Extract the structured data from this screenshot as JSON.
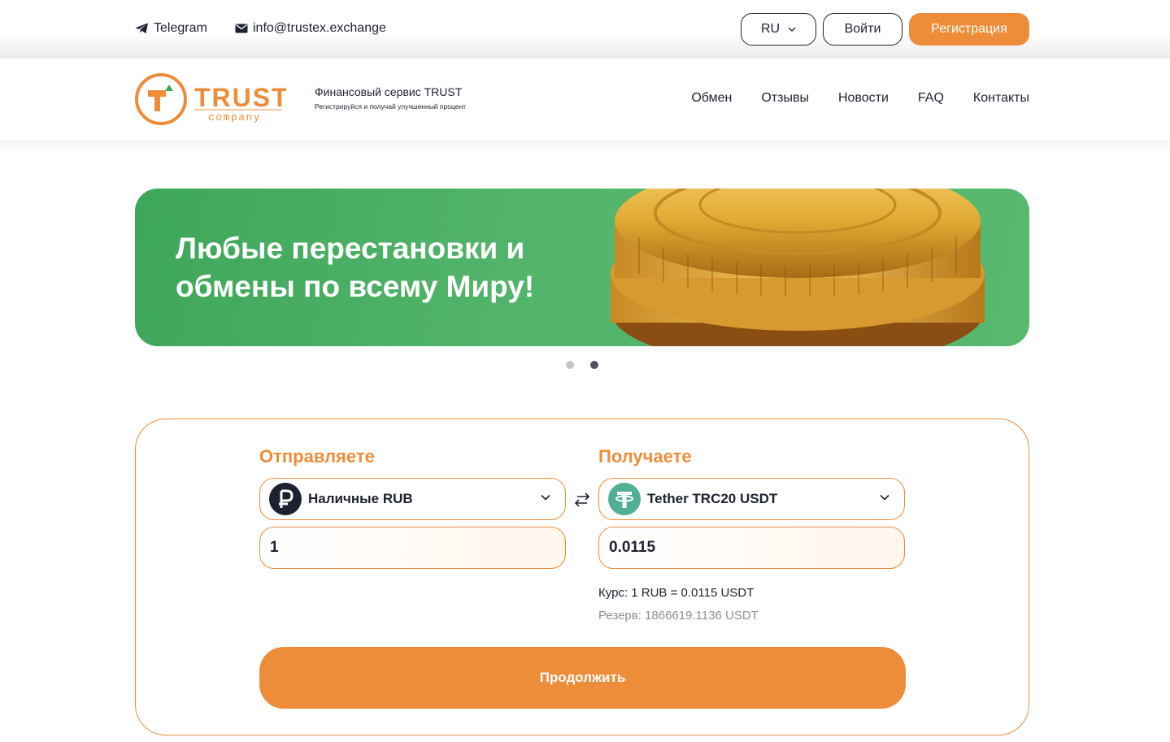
{
  "topbar": {
    "telegram_label": "Telegram",
    "email_label": "info@trustex.exchange",
    "lang_label": "RU",
    "login_label": "Войти",
    "register_label": "Регистрация"
  },
  "header": {
    "logo_word": "TRUST",
    "logo_sub": "company",
    "tagline_title": "Финансовый сервис TRUST",
    "tagline_sub": "Регистрируйся и получай улучшенный процент",
    "nav": [
      "Обмен",
      "Отзывы",
      "Новости",
      "FAQ",
      "Контакты"
    ]
  },
  "banner": {
    "title": "Любые перестановки и обмены по всему Миру!",
    "slides": 2,
    "active_slide": 2
  },
  "exchange": {
    "send_label": "Отправляете",
    "receive_label": "Получаете",
    "send_currency": "Наличные RUB",
    "receive_currency": "Tether TRC20 USDT",
    "send_amount": "1",
    "receive_amount": "0.0115",
    "rate": "Курс: 1 RUB = 0.0115 USDT",
    "reserve": "Резерв: 1866619.1136 USDT",
    "continue_label": "Продолжить"
  },
  "colors": {
    "accent": "#ee8d39",
    "banner_green": "#4caf64",
    "text": "#1d2230",
    "muted": "#8a8f99",
    "tether": "#50af95"
  },
  "icons": [
    "telegram-icon",
    "mail-icon",
    "chevron-down-icon",
    "swap-icon",
    "ruble-icon",
    "tether-icon"
  ]
}
